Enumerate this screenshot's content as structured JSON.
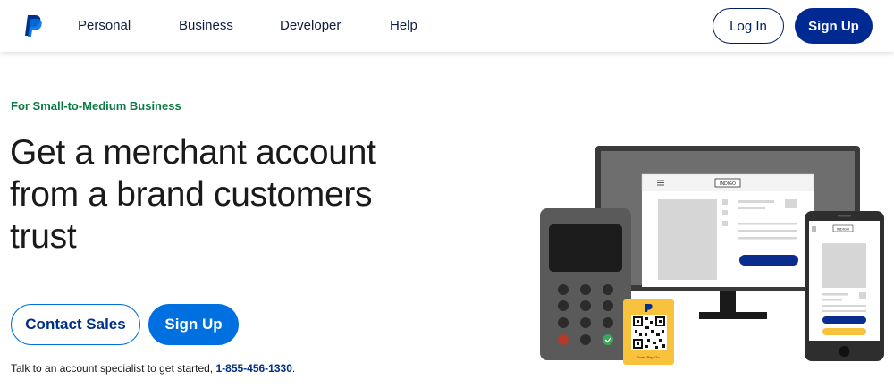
{
  "header": {
    "nav": [
      "Personal",
      "Business",
      "Developer",
      "Help"
    ],
    "login_label": "Log In",
    "signup_label": "Sign Up"
  },
  "hero": {
    "eyebrow": "For Small-to-Medium Business",
    "headline": "Get a merchant account from a brand customers trust",
    "contact_label": "Contact Sales",
    "signup_label": "Sign Up",
    "footnote_text": "Talk to an account specialist to get started, ",
    "phone": "1-855-456-1330",
    "footnote_end": "."
  },
  "illustration": {
    "desktop_brand": "INDIGO",
    "phone_brand": "INDIGO",
    "qr_caption": "Scan. Pay. Go."
  },
  "colors": {
    "brand_navy": "#002991",
    "brand_blue": "#0070e0",
    "eyebrow_green": "#0b7a44",
    "qr_yellow": "#f9c23c"
  }
}
